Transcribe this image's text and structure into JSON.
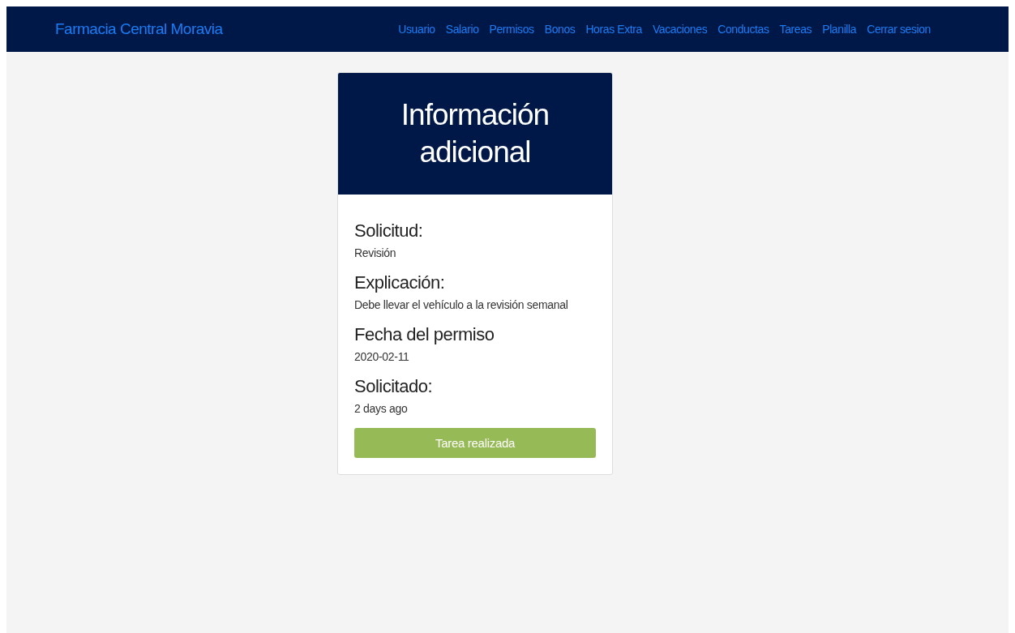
{
  "navbar": {
    "brand": "Farmacia Central Moravia",
    "links": [
      "Usuario",
      "Salario",
      "Permisos",
      "Bonos",
      "Horas Extra",
      "Vacaciones",
      "Conductas",
      "Tareas",
      "Planilla",
      "Cerrar sesion"
    ]
  },
  "card": {
    "title": "Información adicional",
    "fields": [
      {
        "label": "Solicitud:",
        "value": "Revisión"
      },
      {
        "label": "Explicación:",
        "value": "Debe llevar el vehículo a la revisión semanal"
      },
      {
        "label": "Fecha del permiso",
        "value": "2020-02-11"
      },
      {
        "label": "Solicitado:",
        "value": "2 days ago"
      }
    ],
    "button": "Tarea realizada"
  }
}
